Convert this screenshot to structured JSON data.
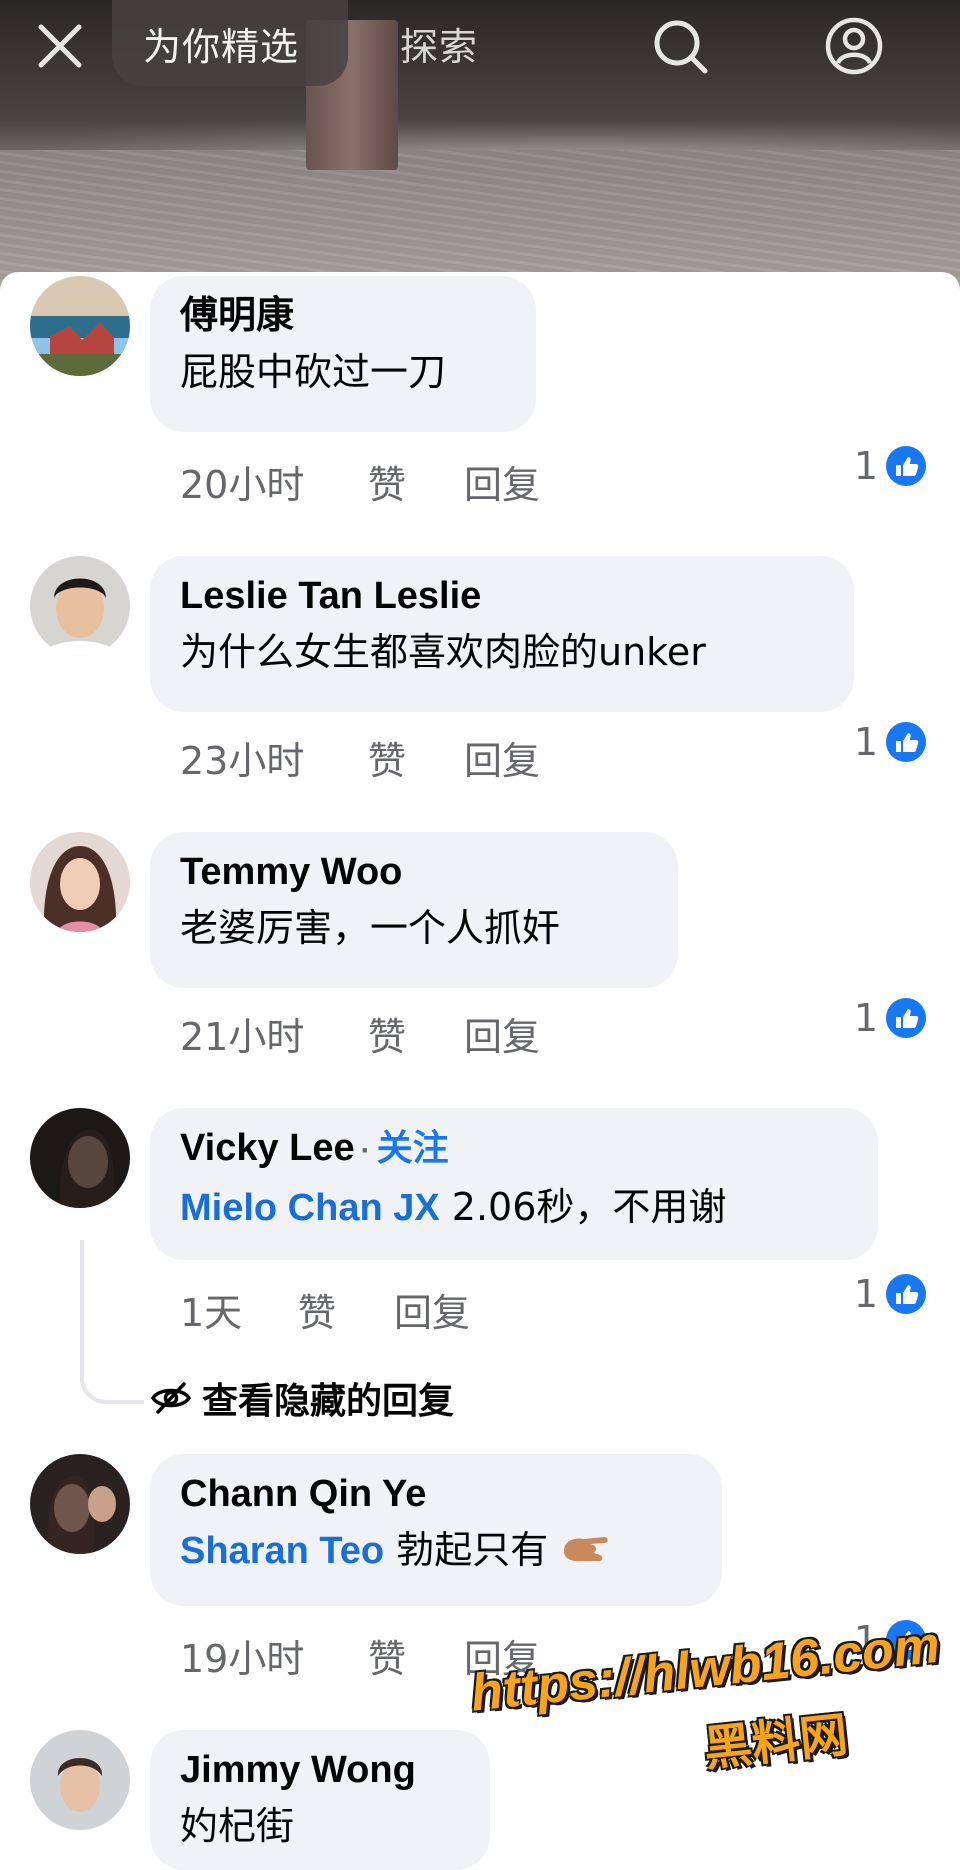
{
  "topbar": {
    "tab_active": "为你精选",
    "tab_explore": "探索",
    "close_icon": "close-icon",
    "search_icon": "search-icon",
    "profile_icon": "profile-icon"
  },
  "labels": {
    "like": "赞",
    "reply": "回复"
  },
  "comments": [
    {
      "author": "傅明康",
      "text": "屁股中砍过一刀",
      "time": "20小时",
      "like_label": "赞",
      "reply_label": "回复",
      "reactions": "1"
    },
    {
      "author": "Leslie Tan Leslie",
      "text": "为什么女生都喜欢肉脸的unker",
      "time": "23小时",
      "like_label": "赞",
      "reply_label": "回复",
      "reactions": "1"
    },
    {
      "author": "Temmy Woo",
      "text": "老婆厉害，一个人抓奸",
      "time": "21小时",
      "like_label": "赞",
      "reply_label": "回复",
      "reactions": "1"
    },
    {
      "author": "Vicky Lee",
      "follow": "关注",
      "mention": "Mielo Chan JX",
      "text": " 2.06秒，不用谢",
      "time": "1天",
      "like_label": "赞",
      "reply_label": "回复",
      "reactions": "1"
    },
    {
      "author": "Chann Qin Ye",
      "mention": "Sharan Teo",
      "text": " 勃起只有",
      "emoji": "🤏",
      "time": "19小时",
      "like_label": "赞",
      "reply_label": "回复",
      "reactions": "1"
    },
    {
      "author": "Jimmy Wong",
      "text": "妁杞街"
    }
  ],
  "hidden_replies": "查看隐藏的回复",
  "watermark": {
    "url": "https://hlwb16.com",
    "name": "黑料网"
  },
  "colors": {
    "accent": "#1877f2",
    "bubble": "#f0f2f5",
    "meta": "#65676b"
  }
}
